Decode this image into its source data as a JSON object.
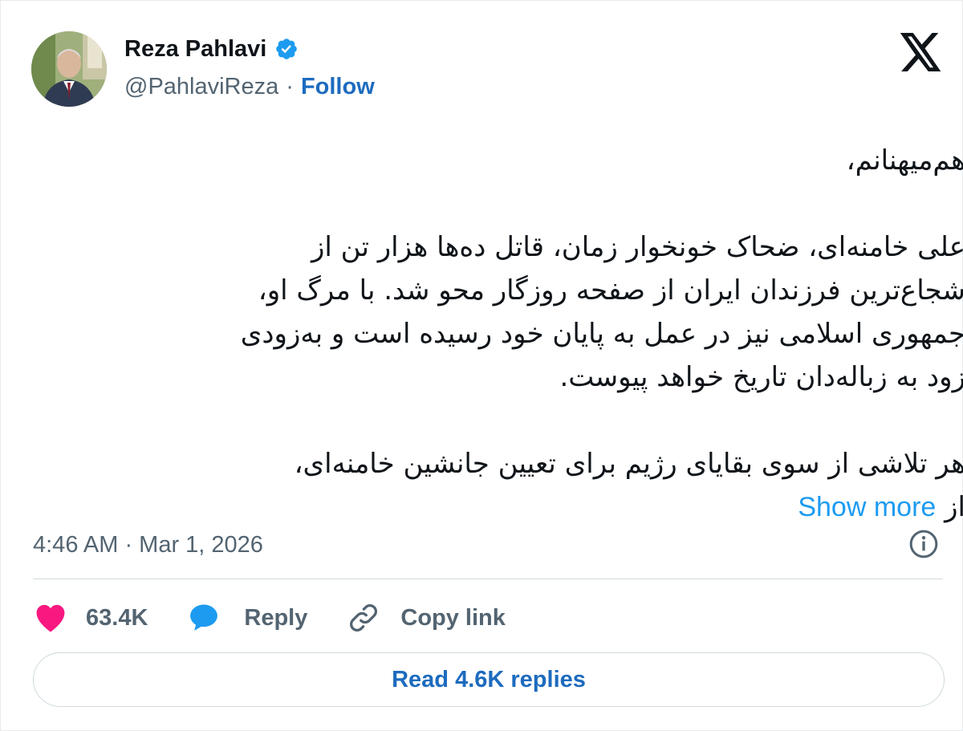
{
  "author": {
    "name": "Reza Pahlavi",
    "handle": "@PahlaviReza",
    "separator": "·",
    "follow_label": "Follow",
    "verified_color": "#1d9bf0"
  },
  "logo_icon": "x-logo-icon",
  "tweet": {
    "lines": [
      "هم‌میهنانم،",
      "علی خامنه‌ای، ضحاک خونخوار زمان، قاتل ده‌ها هزار تن از",
      "شجاع‌ترین فرزندان ایران از صفحه روزگار محو شد. با مرگ او،",
      "جمهوری اسلامی نیز در عمل به پایان خود رسیده است و به‌زودی",
      "زود به زباله‌دان تاریخ خواهد پیوست.",
      "هر تلاشی از سوی بقایای رژیم برای تعیین جانشین خامنه‌ای،",
      "از"
    ],
    "show_more": "Show more"
  },
  "meta": {
    "timestamp": "4:46 AM · Mar 1, 2026",
    "info_icon": "info-icon"
  },
  "actions": {
    "like_count": "63.4K",
    "reply_label": "Reply",
    "copy_label": "Copy link"
  },
  "read_replies": "Read 4.6K replies",
  "colors": {
    "link": "#1d6bbf",
    "accent": "#1d9bf0",
    "heart": "#f91880",
    "text": "#0f1419",
    "muted": "#536471"
  }
}
